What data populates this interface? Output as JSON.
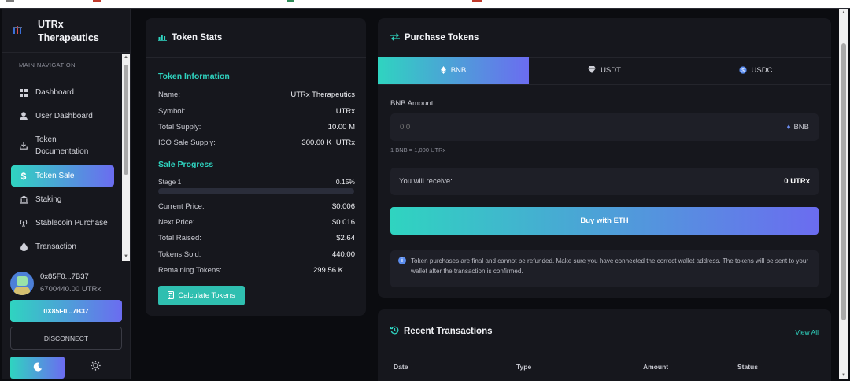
{
  "brand": {
    "title": "UTRx Therapeutics"
  },
  "sidebar": {
    "heading": "MAIN NAVIGATION",
    "items": [
      {
        "label": "Dashboard",
        "icon": "grid-icon"
      },
      {
        "label": "User Dashboard",
        "icon": "user-icon"
      },
      {
        "label": "Token Documentation",
        "icon": "download-icon"
      },
      {
        "label": "Token Sale",
        "icon": "dollar-icon",
        "active": true
      },
      {
        "label": "Staking",
        "icon": "bank-icon"
      },
      {
        "label": "Stablecoin Purchase",
        "icon": "broadcast-icon"
      },
      {
        "label": "Transaction",
        "icon": "droplet-icon"
      }
    ]
  },
  "wallet": {
    "address": "0x85F0...7B37",
    "balance": "6700440.00 UTRx",
    "button_address": "0X85F0...7B37",
    "disconnect": "DISCONNECT"
  },
  "token_stats": {
    "title": "Token Stats",
    "info_title": "Token Information",
    "info": [
      {
        "label": "Name:",
        "value": "UTRx Therapeutics"
      },
      {
        "label": "Symbol:",
        "value": "UTRx"
      },
      {
        "label": "Total Supply:",
        "value": "10.00 M"
      },
      {
        "label": "ICO Sale Supply:",
        "value": "300.00 K  UTRx"
      }
    ],
    "progress_title": "Sale Progress",
    "stage_label": "Stage 1",
    "stage_percent": "0.15%",
    "progress_fraction": 0.0015,
    "stats": [
      {
        "label": "Current Price:",
        "value": "$0.006"
      },
      {
        "label": "Next Price:",
        "value": "$0.016"
      },
      {
        "label": "Total Raised:",
        "value": "$2.64"
      },
      {
        "label": "Tokens Sold:",
        "value": "440.00"
      },
      {
        "label": "Remaining Tokens:",
        "value": "299.56 K"
      }
    ],
    "calc_button": "Calculate Tokens"
  },
  "purchase": {
    "title": "Purchase Tokens",
    "tabs": [
      {
        "label": "BNB",
        "icon": "ethereum-icon",
        "active": true
      },
      {
        "label": "USDT",
        "icon": "diamond-icon"
      },
      {
        "label": "USDC",
        "icon": "coin-icon"
      }
    ],
    "amount_label": "BNB Amount",
    "amount_placeholder": "0.0",
    "amount_currency": "BNB",
    "rate": "1 BNB = 1,000 UTRx",
    "receive_label": "You will receive:",
    "receive_value": "0 UTRx",
    "buy_button": "Buy with ETH",
    "notice": "Token purchases are final and cannot be refunded. Make sure you have connected the correct wallet address. The tokens will be sent to your wallet after the transaction is confirmed."
  },
  "recent": {
    "title": "Recent Transactions",
    "view_all": "View All",
    "columns": [
      "Date",
      "Type",
      "Amount",
      "Status"
    ]
  },
  "colors": {
    "accent_start": "#2fd4c0",
    "accent_end": "#6b6cf0",
    "card": "#16171d",
    "background": "#0b0c10"
  }
}
